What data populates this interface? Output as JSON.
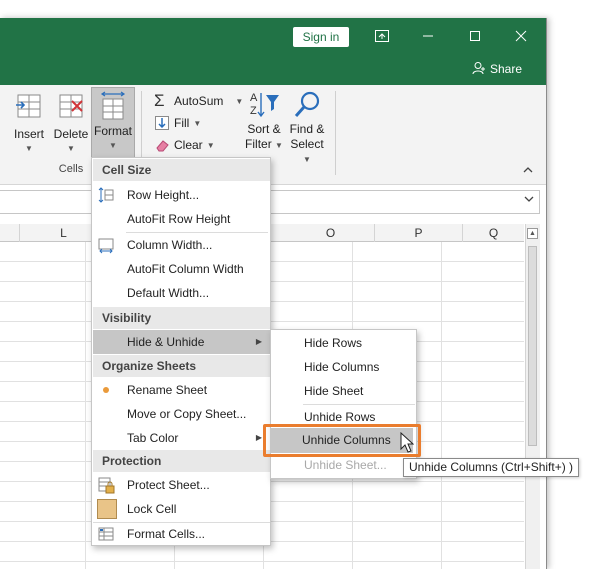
{
  "titlebar": {
    "sign_in": "Sign in",
    "share": "Share",
    "accent": "#217346"
  },
  "ribbon": {
    "insert": "Insert",
    "delete": "Delete",
    "format": "Format",
    "cells_group": "Cells",
    "autosum": "AutoSum",
    "fill": "Fill",
    "clear": "Clear",
    "sort_filter_l1": "Sort &",
    "sort_filter_l2": "Filter",
    "find_select_l1": "Find &",
    "find_select_l2": "Select"
  },
  "columns": [
    "L",
    "O",
    "P",
    "Q"
  ],
  "menu": {
    "cell_size": "Cell Size",
    "row_height": "Row Height...",
    "autofit_row": "AutoFit Row Height",
    "column_width": "Column Width...",
    "autofit_column": "AutoFit Column Width",
    "default_width": "Default Width...",
    "visibility": "Visibility",
    "hide_unhide": "Hide & Unhide",
    "organize": "Organize Sheets",
    "rename_sheet": "Rename Sheet",
    "move_copy": "Move or Copy Sheet...",
    "tab_color": "Tab Color",
    "protection": "Protection",
    "protect_sheet": "Protect Sheet...",
    "lock_cell": "Lock Cell",
    "format_cells": "Format Cells..."
  },
  "submenu": {
    "hide_rows": "Hide Rows",
    "hide_columns": "Hide Columns",
    "hide_sheet": "Hide Sheet",
    "unhide_rows": "Unhide Rows",
    "unhide_columns": "Unhide Columns",
    "unhide_sheet": "Unhide Sheet..."
  },
  "tooltip": "Unhide Columns (Ctrl+Shift+) )",
  "highlight_color": "#ea7d2e"
}
